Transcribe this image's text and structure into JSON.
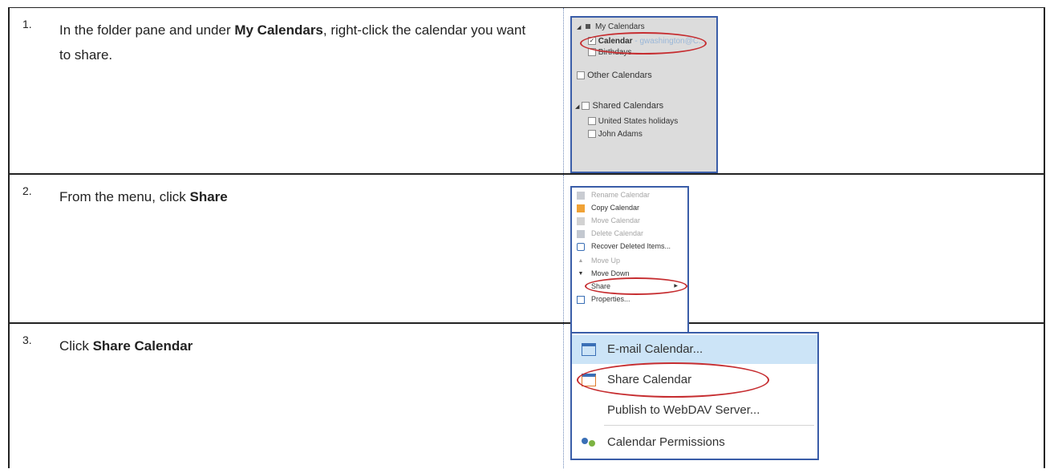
{
  "steps": [
    {
      "number": "1.",
      "text_pre": "In the folder pane and under ",
      "text_bold": "My Calendars",
      "text_post": ", right-click the calendar you want to share.",
      "folder_pane": {
        "my_calendars": "My Calendars",
        "calendar": "Calendar",
        "calendar_owner": " - gwashington@C...",
        "birthdays": "Birthdays",
        "other_calendars": "Other Calendars",
        "shared_calendars": "Shared Calendars",
        "us_holidays": "United States holidays",
        "john_adams": "John Adams"
      }
    },
    {
      "number": "2.",
      "text_pre": "From the menu, click ",
      "text_bold": "Share",
      "context_menu": {
        "rename": "Rename Calendar",
        "copy": "Copy Calendar",
        "move": "Move Calendar",
        "delete": "Delete Calendar",
        "recover": "Recover Deleted Items...",
        "move_up": "Move Up",
        "move_down": "Move Down",
        "share": "Share",
        "properties": "Properties..."
      }
    },
    {
      "number": "3.",
      "text_pre": "Click ",
      "text_bold": "Share Calendar",
      "share_menu": {
        "email": "E-mail Calendar...",
        "share_calendar": "Share Calendar",
        "publish": "Publish to WebDAV Server...",
        "permissions": "Calendar Permissions"
      }
    }
  ],
  "colors": {
    "highlight_oval": "#c62d30",
    "panel_border": "#3a5da8",
    "menu_highlight": "#cce4f7"
  }
}
